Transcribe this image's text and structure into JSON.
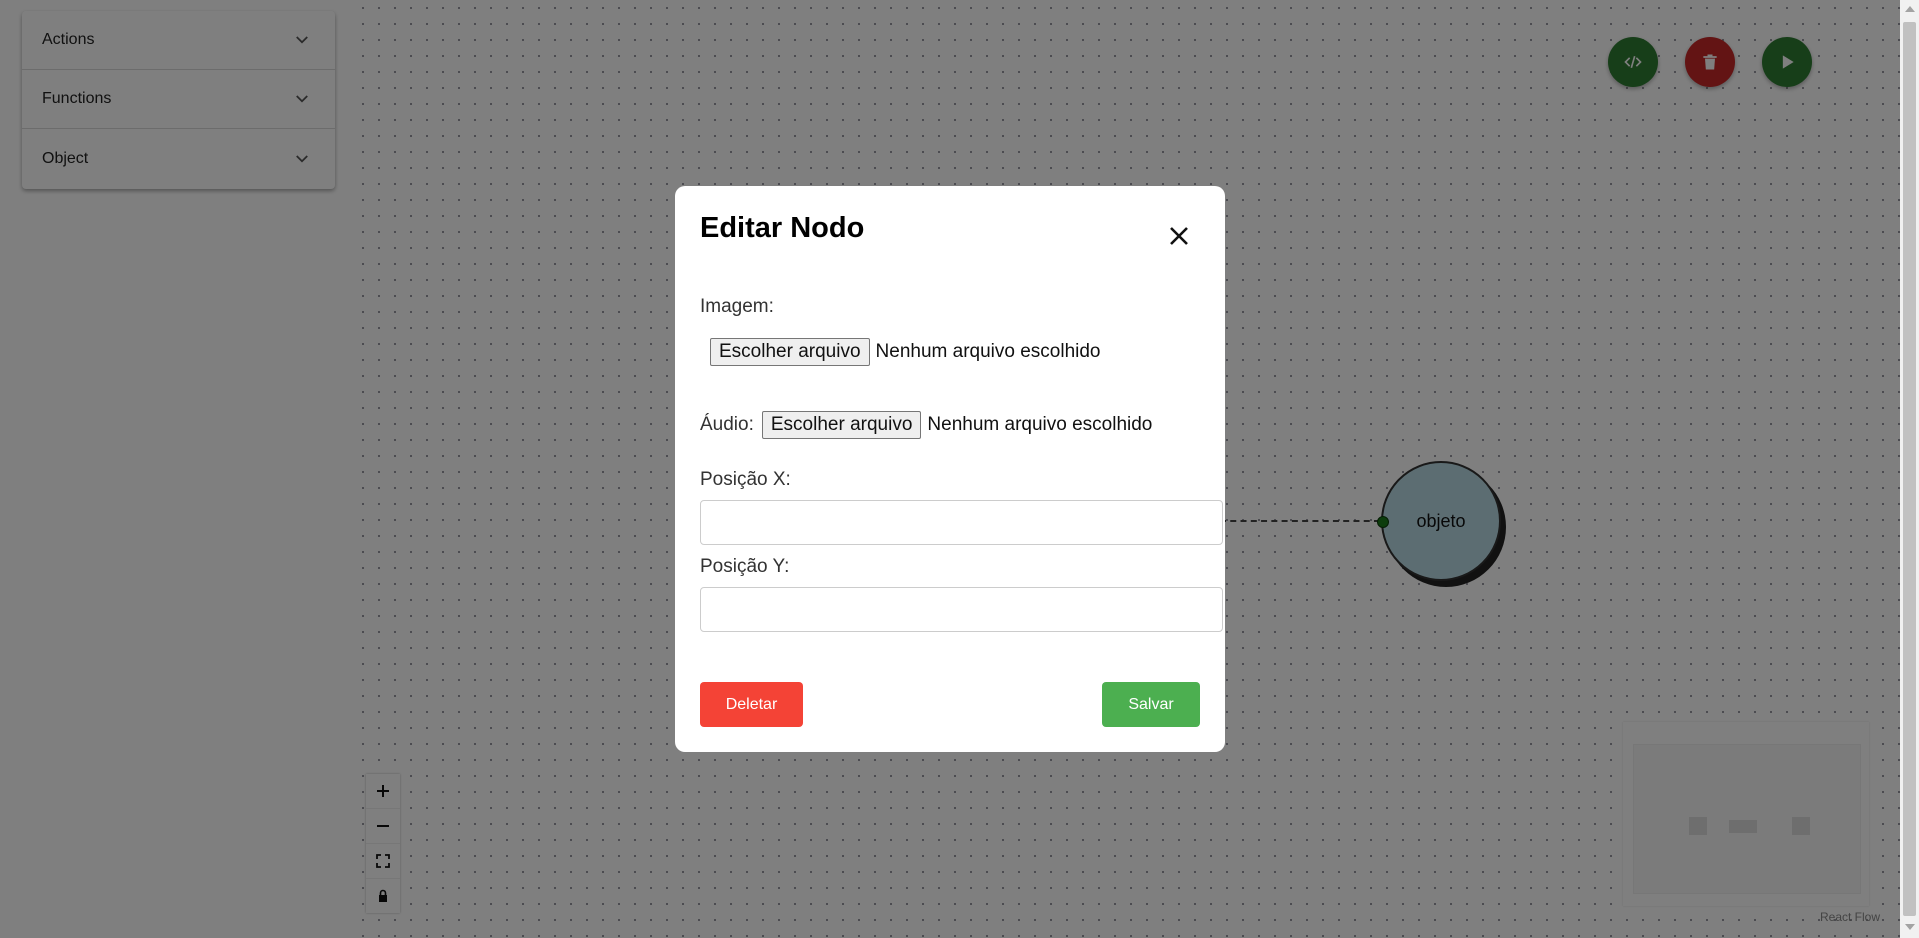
{
  "sidebar": {
    "items": [
      {
        "label": "Actions",
        "icon": "chevron-down-icon"
      },
      {
        "label": "Functions",
        "icon": "chevron-down-icon"
      },
      {
        "label": "Object",
        "icon": "chevron-down-icon"
      }
    ]
  },
  "canvas": {
    "toolbar": [
      {
        "name": "code",
        "icon": "code-icon",
        "color": "#2e7d32"
      },
      {
        "name": "delete",
        "icon": "trash-icon",
        "color": "#c62828"
      },
      {
        "name": "run",
        "icon": "play-icon",
        "color": "#2e7d32"
      }
    ],
    "node": {
      "label": "objeto",
      "color": "#b9dbe4"
    },
    "controls": [
      {
        "name": "zoom-in",
        "icon": "plus-icon"
      },
      {
        "name": "zoom-out",
        "icon": "minus-icon"
      },
      {
        "name": "fit-view",
        "icon": "fit-view-icon"
      },
      {
        "name": "lock",
        "icon": "lock-icon"
      }
    ],
    "attribution": "React Flow"
  },
  "modal": {
    "title": "Editar Nodo",
    "image_label": "Imagem:",
    "image_button": "Escolher arquivo",
    "image_status": "Nenhum arquivo escolhido",
    "audio_label": "Áudio:",
    "audio_button": "Escolher arquivo",
    "audio_status": "Nenhum arquivo escolhido",
    "posx_label": "Posição X:",
    "posx_value": "",
    "posy_label": "Posição Y:",
    "posy_value": "",
    "delete_label": "Deletar",
    "save_label": "Salvar",
    "colors": {
      "delete": "#f44336",
      "save": "#4caf50"
    }
  }
}
